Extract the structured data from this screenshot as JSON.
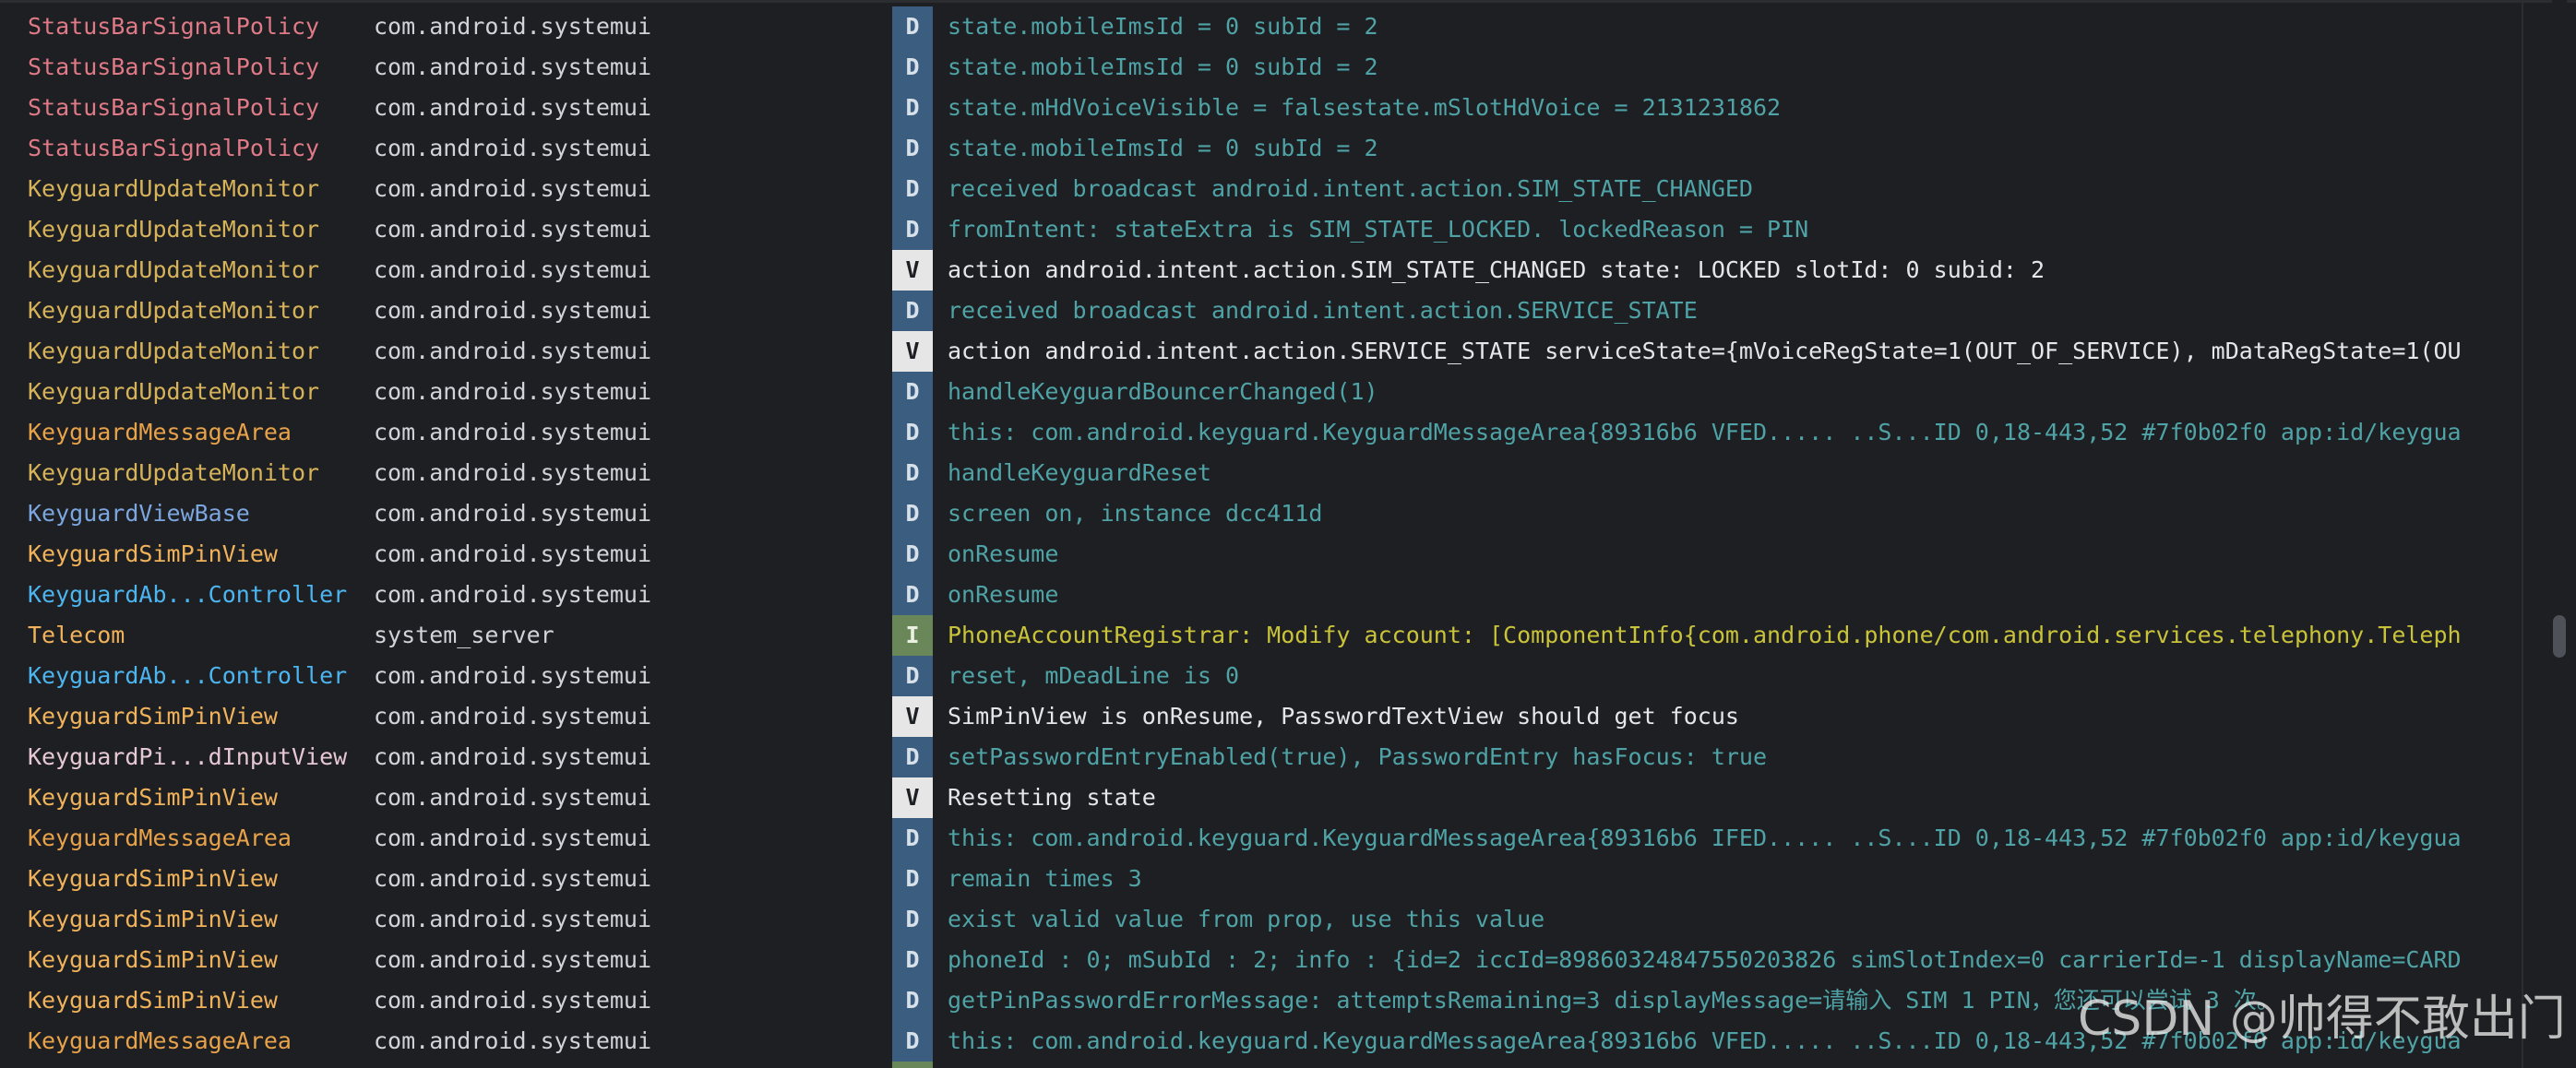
{
  "colors": {
    "background": "#1e1f22",
    "level_debug_bg": "#3a5d80",
    "level_verbose_bg": "#e6e6e6",
    "level_info_bg": "#6a8759",
    "msg_debug": "#4fa3a6",
    "msg_verbose": "#e4e6ea",
    "msg_info": "#c9c33a"
  },
  "log": {
    "rows": [
      {
        "tag": "StatusBarSignalPolicy",
        "tag_color": "pink",
        "package": "com.android.systemui",
        "level": "D",
        "message": "state.mobileImsId = 0 subId = 2"
      },
      {
        "tag": "StatusBarSignalPolicy",
        "tag_color": "pink",
        "package": "com.android.systemui",
        "level": "D",
        "message": "state.mobileImsId = 0 subId = 2"
      },
      {
        "tag": "StatusBarSignalPolicy",
        "tag_color": "pink",
        "package": "com.android.systemui",
        "level": "D",
        "message": "state.mHdVoiceVisible = falsestate.mSlotHdVoice = 2131231862"
      },
      {
        "tag": "StatusBarSignalPolicy",
        "tag_color": "pink",
        "package": "com.android.systemui",
        "level": "D",
        "message": "state.mobileImsId = 0 subId = 2"
      },
      {
        "tag": "KeyguardUpdateMonitor",
        "tag_color": "yellow",
        "package": "com.android.systemui",
        "level": "D",
        "message": "received broadcast android.intent.action.SIM_STATE_CHANGED"
      },
      {
        "tag": "KeyguardUpdateMonitor",
        "tag_color": "yellow",
        "package": "com.android.systemui",
        "level": "D",
        "message": "fromIntent: stateExtra is SIM_STATE_LOCKED. lockedReason = PIN"
      },
      {
        "tag": "KeyguardUpdateMonitor",
        "tag_color": "yellow",
        "package": "com.android.systemui",
        "level": "V",
        "message": "action android.intent.action.SIM_STATE_CHANGED state: LOCKED slotId: 0 subid: 2"
      },
      {
        "tag": "KeyguardUpdateMonitor",
        "tag_color": "yellow",
        "package": "com.android.systemui",
        "level": "D",
        "message": "received broadcast android.intent.action.SERVICE_STATE"
      },
      {
        "tag": "KeyguardUpdateMonitor",
        "tag_color": "yellow",
        "package": "com.android.systemui",
        "level": "V",
        "message": "action android.intent.action.SERVICE_STATE serviceState={mVoiceRegState=1(OUT_OF_SERVICE), mDataRegState=1(OU"
      },
      {
        "tag": "KeyguardUpdateMonitor",
        "tag_color": "yellow",
        "package": "com.android.systemui",
        "level": "D",
        "message": "handleKeyguardBouncerChanged(1)"
      },
      {
        "tag": "KeyguardMessageArea",
        "tag_color": "orange",
        "package": "com.android.systemui",
        "level": "D",
        "message": "this: com.android.keyguard.KeyguardMessageArea{89316b6 VFED..... ..S...ID 0,18-443,52 #7f0b02f0 app:id/keygua"
      },
      {
        "tag": "KeyguardUpdateMonitor",
        "tag_color": "yellow",
        "package": "com.android.systemui",
        "level": "D",
        "message": "handleKeyguardReset"
      },
      {
        "tag": "KeyguardViewBase",
        "tag_color": "blue",
        "package": "com.android.systemui",
        "level": "D",
        "message": "screen on, instance dcc411d"
      },
      {
        "tag": "KeyguardSimPinView",
        "tag_color": "lightorange",
        "package": "com.android.systemui",
        "level": "D",
        "message": "onResume"
      },
      {
        "tag": "KeyguardAb...Controller",
        "tag_color": "cyan",
        "package": "com.android.systemui",
        "level": "D",
        "message": "onResume"
      },
      {
        "tag": "Telecom",
        "tag_color": "lightorange",
        "package": "system_server",
        "level": "I",
        "message": "PhoneAccountRegistrar: Modify account: [ComponentInfo{com.android.phone/com.android.services.telephony.Teleph"
      },
      {
        "tag": "KeyguardAb...Controller",
        "tag_color": "cyan",
        "package": "com.android.systemui",
        "level": "D",
        "message": "reset, mDeadLine is 0"
      },
      {
        "tag": "KeyguardSimPinView",
        "tag_color": "lightorange",
        "package": "com.android.systemui",
        "level": "V",
        "message": "SimPinView is onResume, PasswordTextView should get focus"
      },
      {
        "tag": "KeyguardPi...dInputView",
        "tag_color": "white",
        "package": "com.android.systemui",
        "level": "D",
        "message": "setPasswordEntryEnabled(true), PasswordEntry hasFocus: true"
      },
      {
        "tag": "KeyguardSimPinView",
        "tag_color": "lightorange",
        "package": "com.android.systemui",
        "level": "V",
        "message": "Resetting state"
      },
      {
        "tag": "KeyguardMessageArea",
        "tag_color": "orange",
        "package": "com.android.systemui",
        "level": "D",
        "message": "this: com.android.keyguard.KeyguardMessageArea{89316b6 IFED..... ..S...ID 0,18-443,52 #7f0b02f0 app:id/keygua"
      },
      {
        "tag": "KeyguardSimPinView",
        "tag_color": "lightorange",
        "package": "com.android.systemui",
        "level": "D",
        "message": "remain times 3"
      },
      {
        "tag": "KeyguardSimPinView",
        "tag_color": "lightorange",
        "package": "com.android.systemui",
        "level": "D",
        "message": "exist valid value from prop, use this value"
      },
      {
        "tag": "KeyguardSimPinView",
        "tag_color": "lightorange",
        "package": "com.android.systemui",
        "level": "D",
        "message": "phoneId : 0; mSubId : 2; info : {id=2 iccId=89860324847550203826 simSlotIndex=0 carrierId=-1 displayName=CARD"
      },
      {
        "tag": "KeyguardSimPinView",
        "tag_color": "lightorange",
        "package": "com.android.systemui",
        "level": "D",
        "message": "getPinPasswordErrorMessage: attemptsRemaining=3 displayMessage=请输入 SIM 1 PIN，您还可以尝试 3 次。"
      },
      {
        "tag": "KeyguardMessageArea",
        "tag_color": "orange",
        "package": "com.android.systemui",
        "level": "D",
        "message": "this: com.android.keyguard.KeyguardMessageArea{89316b6 VFED..... ..S...ID 0,18-443,52 #7f0b02f0 app:id/keygua"
      }
    ]
  },
  "scrollbar": {
    "position_fraction": 0.6
  },
  "watermark": {
    "text": "CSDN @帅得不敢出门"
  }
}
